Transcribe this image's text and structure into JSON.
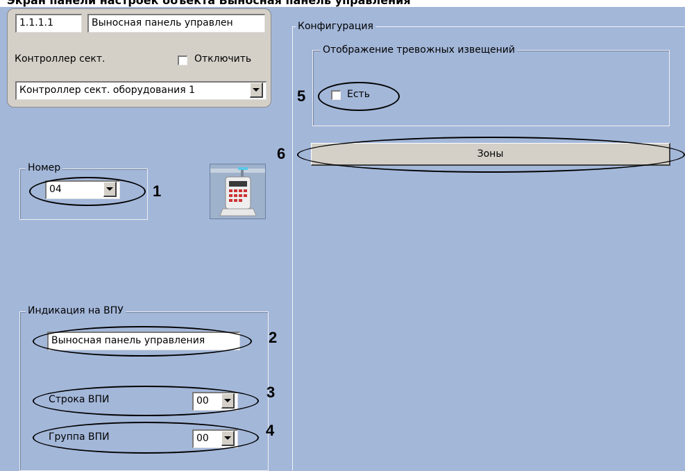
{
  "header": {
    "cut_text": "Экран панели настроек объекта Выносная панель управления"
  },
  "panel": {
    "id": "1.1.1.1",
    "name": "Выносная панель управлен",
    "type_label": "Контроллер сект.",
    "disable_label": "Отключить",
    "controller_value": "Контроллер сект. оборудования 1"
  },
  "number_group": {
    "legend": "Номер",
    "value": "04"
  },
  "indication_group": {
    "legend": "Индикация на ВПУ",
    "text_value": "Выносная панель управления",
    "row_label": "Строка ВПИ",
    "row_value": "00",
    "group_label": "Группа ВПИ",
    "group_value": "00"
  },
  "config_group": {
    "legend": "Конфигурация",
    "alarm_legend": "Отображение тревожных извещений",
    "exists_label": "Есть",
    "zones_button": "Зоны"
  },
  "callouts": {
    "c1": "1",
    "c2": "2",
    "c3": "3",
    "c4": "4",
    "c5": "5",
    "c6": "6"
  }
}
